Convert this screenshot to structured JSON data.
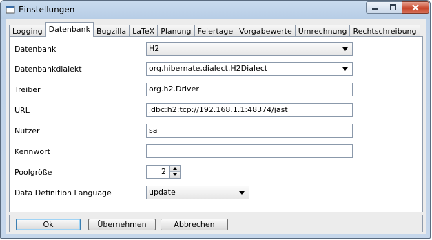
{
  "window": {
    "title": "Einstellungen",
    "controls": {
      "minimize": "minimize-icon",
      "maximize": "maximize-icon",
      "close": "close-icon"
    }
  },
  "tabs": [
    {
      "label": "Logging"
    },
    {
      "label": "Datenbank",
      "active": true
    },
    {
      "label": "Bugzilla"
    },
    {
      "label": "LaTeX"
    },
    {
      "label": "Planung"
    },
    {
      "label": "Feiertage"
    },
    {
      "label": "Vorgabewerte"
    },
    {
      "label": "Umrechnung"
    },
    {
      "label": "Rechtschreibung"
    }
  ],
  "form": {
    "datenbank": {
      "label": "Datenbank",
      "value": "H2"
    },
    "dialekt": {
      "label": "Datenbankdialekt",
      "value": "org.hibernate.dialect.H2Dialect"
    },
    "treiber": {
      "label": "Treiber",
      "value": "org.h2.Driver"
    },
    "url": {
      "label": "URL",
      "value": "jdbc:h2:tcp://192.168.1.1:48374/jast"
    },
    "nutzer": {
      "label": "Nutzer",
      "value": "sa"
    },
    "kennwort": {
      "label": "Kennwort",
      "value": ""
    },
    "poolgroesse": {
      "label": "Poolgröße",
      "value": "2"
    },
    "ddl": {
      "label": "Data Definition Language",
      "value": "update"
    }
  },
  "buttons": {
    "ok": "Ok",
    "apply": "Übernehmen",
    "cancel": "Abbrechen"
  }
}
